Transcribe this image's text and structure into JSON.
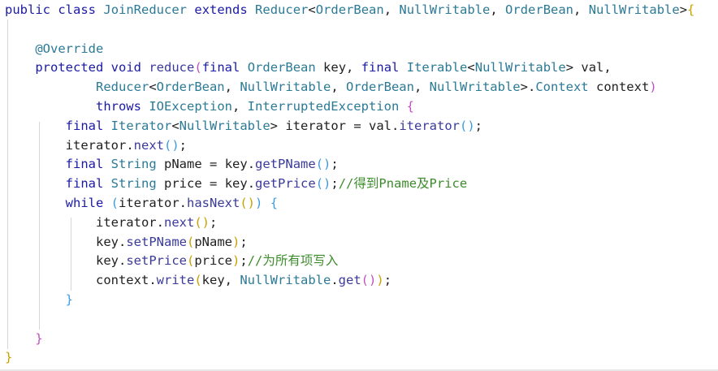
{
  "lines": [
    [
      [
        "kw",
        "public"
      ],
      [
        "pun",
        " "
      ],
      [
        "kw",
        "class"
      ],
      [
        "pun",
        " "
      ],
      [
        "type",
        "JoinReducer"
      ],
      [
        "pun",
        " "
      ],
      [
        "kw",
        "extends"
      ],
      [
        "pun",
        " "
      ],
      [
        "type",
        "Reducer"
      ],
      [
        "pun",
        "<"
      ],
      [
        "type",
        "OrderBean"
      ],
      [
        "pun",
        ", "
      ],
      [
        "type",
        "NullWritable"
      ],
      [
        "pun",
        ", "
      ],
      [
        "type",
        "OrderBean"
      ],
      [
        "pun",
        ", "
      ],
      [
        "type",
        "NullWritable"
      ],
      [
        "pun",
        ">"
      ],
      [
        "b1",
        "{"
      ]
    ],
    [],
    [
      [
        "pun",
        "    "
      ],
      [
        "ann",
        "@Override"
      ]
    ],
    [
      [
        "pun",
        "    "
      ],
      [
        "kw",
        "protected"
      ],
      [
        "pun",
        " "
      ],
      [
        "kw",
        "void"
      ],
      [
        "pun",
        " "
      ],
      [
        "fn",
        "reduce"
      ],
      [
        "b2",
        "("
      ],
      [
        "kw",
        "final"
      ],
      [
        "pun",
        " "
      ],
      [
        "type",
        "OrderBean"
      ],
      [
        "pun",
        " "
      ],
      [
        "id",
        "key"
      ],
      [
        "pun",
        ", "
      ],
      [
        "kw",
        "final"
      ],
      [
        "pun",
        " "
      ],
      [
        "type",
        "Iterable"
      ],
      [
        "pun",
        "<"
      ],
      [
        "type",
        "NullWritable"
      ],
      [
        "pun",
        "> "
      ],
      [
        "id",
        "val"
      ],
      [
        "pun",
        ","
      ]
    ],
    [
      [
        "pun",
        "            "
      ],
      [
        "type",
        "Reducer"
      ],
      [
        "pun",
        "<"
      ],
      [
        "type",
        "OrderBean"
      ],
      [
        "pun",
        ", "
      ],
      [
        "type",
        "NullWritable"
      ],
      [
        "pun",
        ", "
      ],
      [
        "type",
        "OrderBean"
      ],
      [
        "pun",
        ", "
      ],
      [
        "type",
        "NullWritable"
      ],
      [
        "pun",
        ">."
      ],
      [
        "type",
        "Context"
      ],
      [
        "pun",
        " "
      ],
      [
        "id",
        "context"
      ],
      [
        "b2",
        ")"
      ]
    ],
    [
      [
        "pun",
        "            "
      ],
      [
        "kw",
        "throws"
      ],
      [
        "pun",
        " "
      ],
      [
        "type",
        "IOException"
      ],
      [
        "pun",
        ", "
      ],
      [
        "type",
        "InterruptedException"
      ],
      [
        "pun",
        " "
      ],
      [
        "b2",
        "{"
      ]
    ],
    [
      [
        "pun",
        "        "
      ],
      [
        "kw",
        "final"
      ],
      [
        "pun",
        " "
      ],
      [
        "type",
        "Iterator"
      ],
      [
        "pun",
        "<"
      ],
      [
        "type",
        "NullWritable"
      ],
      [
        "pun",
        "> "
      ],
      [
        "id",
        "iterator"
      ],
      [
        "pun",
        " = "
      ],
      [
        "id",
        "val"
      ],
      [
        "pun",
        "."
      ],
      [
        "fn",
        "iterator"
      ],
      [
        "b3",
        "()"
      ],
      [
        "pun",
        ";"
      ]
    ],
    [
      [
        "pun",
        "        "
      ],
      [
        "id",
        "iterator"
      ],
      [
        "pun",
        "."
      ],
      [
        "fn",
        "next"
      ],
      [
        "b3",
        "()"
      ],
      [
        "pun",
        ";"
      ]
    ],
    [
      [
        "pun",
        "        "
      ],
      [
        "kw",
        "final"
      ],
      [
        "pun",
        " "
      ],
      [
        "type",
        "String"
      ],
      [
        "pun",
        " "
      ],
      [
        "id",
        "pName"
      ],
      [
        "pun",
        " = "
      ],
      [
        "id",
        "key"
      ],
      [
        "pun",
        "."
      ],
      [
        "fn",
        "getPName"
      ],
      [
        "b3",
        "()"
      ],
      [
        "pun",
        ";"
      ]
    ],
    [
      [
        "pun",
        "        "
      ],
      [
        "kw",
        "final"
      ],
      [
        "pun",
        " "
      ],
      [
        "type",
        "String"
      ],
      [
        "pun",
        " "
      ],
      [
        "id",
        "price"
      ],
      [
        "pun",
        " = "
      ],
      [
        "id",
        "key"
      ],
      [
        "pun",
        "."
      ],
      [
        "fn",
        "getPrice"
      ],
      [
        "b3",
        "()"
      ],
      [
        "pun",
        ";"
      ],
      [
        "cm",
        "//得到Pname及Price"
      ]
    ],
    [
      [
        "pun",
        "        "
      ],
      [
        "kw",
        "while"
      ],
      [
        "pun",
        " "
      ],
      [
        "b3",
        "("
      ],
      [
        "id",
        "iterator"
      ],
      [
        "pun",
        "."
      ],
      [
        "fn",
        "hasNext"
      ],
      [
        "b1",
        "()"
      ],
      [
        "b3",
        ")"
      ],
      [
        "pun",
        " "
      ],
      [
        "b3",
        "{"
      ]
    ],
    [
      [
        "pun",
        "            "
      ],
      [
        "id",
        "iterator"
      ],
      [
        "pun",
        "."
      ],
      [
        "fn",
        "next"
      ],
      [
        "b1",
        "()"
      ],
      [
        "pun",
        ";"
      ]
    ],
    [
      [
        "pun",
        "            "
      ],
      [
        "id",
        "key"
      ],
      [
        "pun",
        "."
      ],
      [
        "fn",
        "setPName"
      ],
      [
        "b1",
        "("
      ],
      [
        "id",
        "pName"
      ],
      [
        "b1",
        ")"
      ],
      [
        "pun",
        ";"
      ]
    ],
    [
      [
        "pun",
        "            "
      ],
      [
        "id",
        "key"
      ],
      [
        "pun",
        "."
      ],
      [
        "fn",
        "setPrice"
      ],
      [
        "b1",
        "("
      ],
      [
        "id",
        "price"
      ],
      [
        "b1",
        ")"
      ],
      [
        "pun",
        ";"
      ],
      [
        "cm",
        "//为所有项写入"
      ]
    ],
    [
      [
        "pun",
        "            "
      ],
      [
        "id",
        "context"
      ],
      [
        "pun",
        "."
      ],
      [
        "fn",
        "write"
      ],
      [
        "b1",
        "("
      ],
      [
        "id",
        "key"
      ],
      [
        "pun",
        ", "
      ],
      [
        "type",
        "NullWritable"
      ],
      [
        "pun",
        "."
      ],
      [
        "fn",
        "get"
      ],
      [
        "b2",
        "()"
      ],
      [
        "b1",
        ")"
      ],
      [
        "pun",
        ";"
      ]
    ],
    [
      [
        "pun",
        "        "
      ],
      [
        "b3",
        "}"
      ]
    ],
    [],
    [
      [
        "pun",
        "    "
      ],
      [
        "b2",
        "}"
      ]
    ],
    [
      [
        "b1",
        "}"
      ]
    ]
  ]
}
